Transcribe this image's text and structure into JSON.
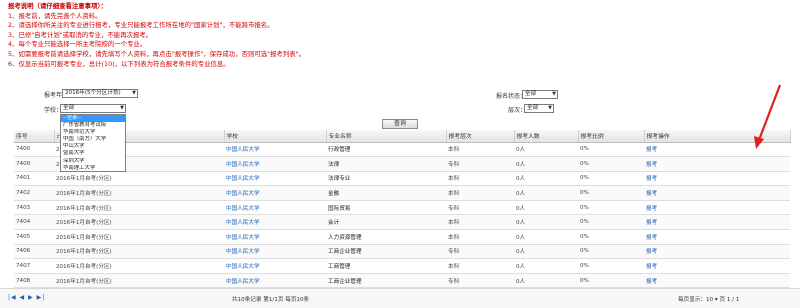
{
  "notice": {
    "title": "报考说明（请仔细查看注意事项）：",
    "lines": [
      "1、报考前，请先完善个人资料。",
      "2、请选择你所关注的专业进行报考，专业只能报考工作所在地的\"国家计划\"，不能跨市报名。",
      "3、已修\"自考计划\"或取消的专业，不能再次报考。",
      "4、每个专业只能选择一所主考院校的一个专业。",
      "5、如需要报考前请选择学校，请先填写个人资料，再点击\"报考操作\"，保存成功，否则可选\"报考列表\"。",
      "6、仅显示当前可报考专业，总计(10)，以下列表为符合报考条件的专业信息。"
    ]
  },
  "filters": {
    "year_label": "报考年：",
    "year_value": "2016年(5个分区计划)",
    "level_label": "层次：",
    "level_value": "全部",
    "status_label": "报名状态：",
    "status_value": "全部",
    "school_label": "学校：",
    "school_value": "全部",
    "query_button": "查询"
  },
  "dropdown": {
    "options": [
      "--全部--",
      "广东省教育考试院",
      "华南师范大学",
      "中国（南方）大学",
      "中山大学",
      "暨南大学",
      "深圳大学",
      "华南理工大学"
    ],
    "selected_index": 0
  },
  "table": {
    "headers": [
      "序号",
      "计划名称",
      "学校",
      "专业名称",
      "报考层次",
      "报考人数",
      "报考比例",
      "报考操作"
    ],
    "rows": [
      [
        "7400",
        "2016年（1-5月）（分区）",
        "中国人民大学",
        "行政管理",
        "本科",
        "0人",
        "0%",
        "报考"
      ],
      [
        "7400",
        "2016年1月自考(分区)",
        "中国人民大学",
        "法律",
        "专科",
        "0人",
        "0%",
        "报考"
      ],
      [
        "7401",
        "2016年1月自考(分区)",
        "中国人民大学",
        "法律专业",
        "本科",
        "0人",
        "0%",
        "报考"
      ],
      [
        "7402",
        "2016年1月自考(分区)",
        "中国人民大学",
        "金融",
        "本科",
        "0人",
        "0%",
        "报考"
      ],
      [
        "7403",
        "2016年1月自考(分区)",
        "中国人民大学",
        "国际贸易",
        "专科",
        "0人",
        "0%",
        "报考"
      ],
      [
        "7404",
        "2016年1月自考(分区)",
        "中国人民大学",
        "会计",
        "本科",
        "0人",
        "0%",
        "报考"
      ],
      [
        "7405",
        "2016年1月自考(分区)",
        "中国人民大学",
        "人力资源管理",
        "本科",
        "0人",
        "0%",
        "报考"
      ],
      [
        "7406",
        "2016年1月自考(分区)",
        "中国人民大学",
        "工商企业管理",
        "专科",
        "0人",
        "0%",
        "报考"
      ],
      [
        "7407",
        "2016年1月自考(分区)",
        "中国人民大学",
        "工商管理",
        "本科",
        "0人",
        "0%",
        "报考"
      ],
      [
        "7408",
        "2016年1月自考(分区)",
        "中国人民大学",
        "工商企业管理",
        "专科",
        "0人",
        "0%",
        "报考"
      ]
    ]
  },
  "pager": {
    "nav": "|◀ ◀ ▶ ▶|",
    "info": "共10条记录 第1/1页 每页10条",
    "size": "每页显示：10 ▾  页 1 / 1"
  },
  "colors": {
    "notice": "#d40000",
    "link": "#1a5fb4",
    "arrow": "#e02020"
  }
}
